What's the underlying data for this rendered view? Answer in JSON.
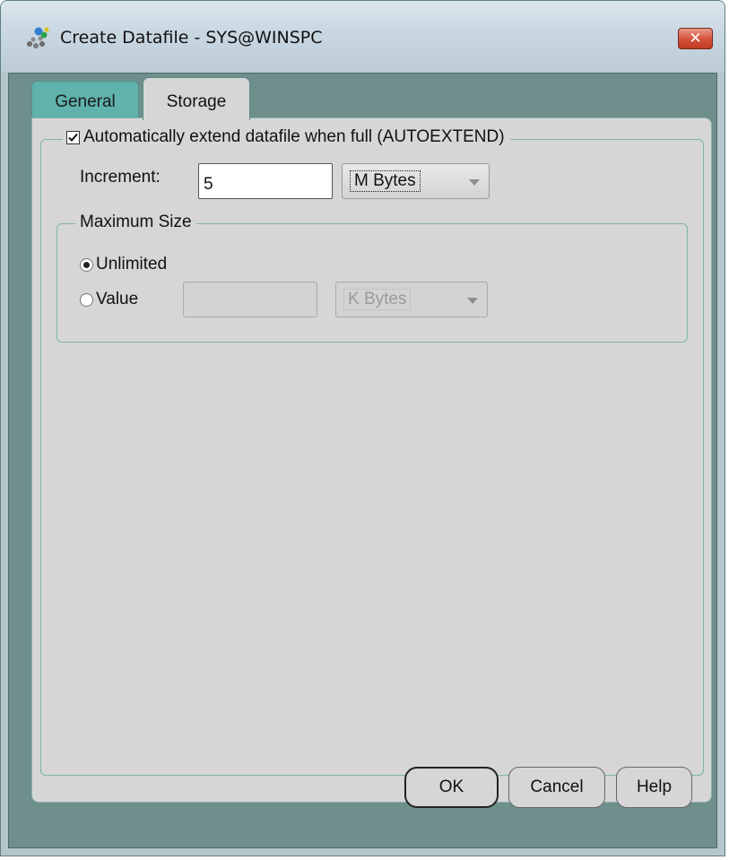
{
  "window": {
    "title": "Create Datafile - SYS@WINSPC",
    "close_glyph": "✕",
    "icon": "database-icon"
  },
  "tabs": [
    {
      "label": "General",
      "selected": false
    },
    {
      "label": "Storage",
      "selected": true
    }
  ],
  "autoextend": {
    "label": "Automatically extend datafile when full (AUTOEXTEND)",
    "checked": true
  },
  "increment": {
    "label": "Increment:",
    "value": "5",
    "unit": "M Bytes"
  },
  "maximum_size": {
    "legend": "Maximum Size",
    "unlimited_label": "Unlimited",
    "unlimited_checked": true,
    "value_label": "Value",
    "value": "",
    "unit": "K Bytes",
    "value_enabled": false
  },
  "buttons": {
    "ok": "OK",
    "cancel": "Cancel",
    "help": "Help"
  },
  "colors": {
    "dialog_background": "#6e8f8c",
    "tab_general": "#5fb3ac",
    "panel": "#d6d6d6",
    "close_button": "#d5543d"
  }
}
